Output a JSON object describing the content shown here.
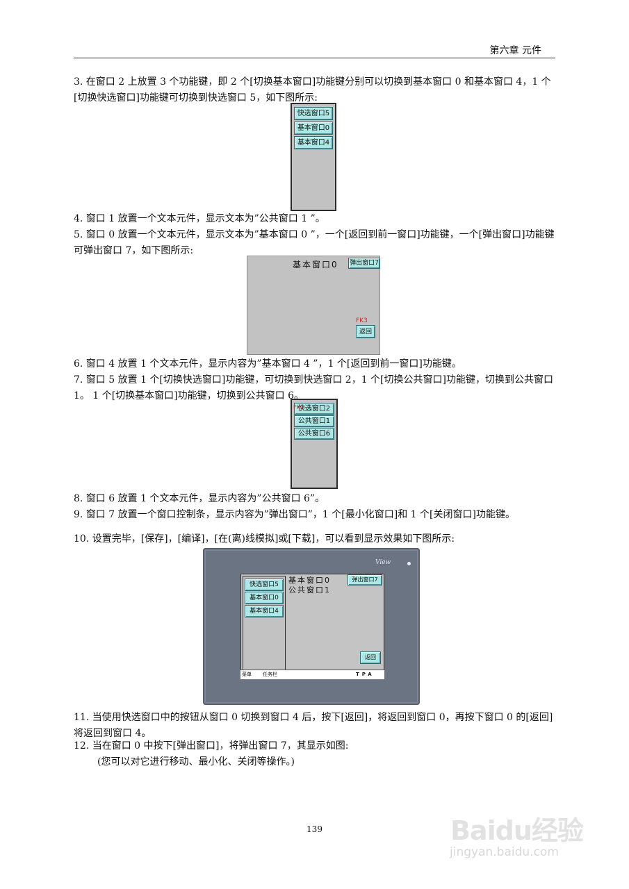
{
  "header": {
    "title": "第六章 元件"
  },
  "paragraphs": {
    "p3": "3. 在窗口 2 上放置 3 个功能键，即 2 个[切换基本窗口]功能键分别可以切换到基本窗口 0 和基本窗口 4，1 个[切换快选窗口]功能键可切换到快选窗口 5，如下图所示:",
    "p4": "4. 窗口 1 放置一个文本元件，显示文本为”公共窗口 1 ”。",
    "p5": "5. 窗口 0 放置一个文本元件，显示文本为”基本窗口 0 ”，一个[返回到前一窗口]功能键，一个[弹出窗口]功能键可弹出窗口 7，如下图所示:",
    "p6": "6. 窗口 4 放置 1 个文本元件，显示内容为”基本窗口 4 ”，1 个[返回到前一窗口]功能键。",
    "p7": "7. 窗口 5 放置 1 个[切换快选窗口]功能键，可切换到快选窗口 2，1 个[切换公共窗口]功能键，切换到公共窗口 1。 1 个[切换基本窗口]功能键，切换到公共窗口 6。",
    "p8": "8. 窗口 6 放置 1 个文本元件，显示内容为”公共窗口 6”。",
    "p9": "9. 窗口 7 放置一个窗口控制条，显示内容为”弹出窗口”，1 个[最小化窗口]和 1 个[关闭窗口]功能键。",
    "p10": "10. 设置完毕，[保存]，[编译]，[在(离)线模拟]或[下载]，可以看到显示效果如下图所示:",
    "p11": "11. 当使用快选窗口中的按钮从窗口 0 切换到窗口 4 后，按下[返回]，将返回到窗口 0，再按下窗口 0 的[返回]将返回到窗口 4。",
    "p12": "12. 当在窗口 0 中按下[弹出窗口]，将弹出窗口 7，其显示如图:",
    "p12_note": "(您可以对它进行移动、最小化、关闭等操作。)"
  },
  "fig1": {
    "buttons": [
      "快选窗口5",
      "基本窗口0",
      "基本窗口4"
    ]
  },
  "fig2": {
    "text": "基本窗口0",
    "popup_button": "弹出窗口7",
    "fk_label": "FK3",
    "back_button": "返回"
  },
  "fig3": {
    "fk_label": "FK0",
    "buttons": [
      "快选窗口2",
      "公共窗口1",
      "公共窗口6"
    ]
  },
  "fig4": {
    "logo": "View",
    "quick_buttons": [
      "快选窗口5",
      "基本窗口0",
      "基本窗口4"
    ],
    "text_line1": "基本窗口0",
    "text_line2": "公共窗口1",
    "popup_button": "弹出窗口7",
    "back_button": "返回",
    "taskbar_menu": "菜单",
    "taskbar_tasks": "任务栏",
    "taskbar_icons": "TPA"
  },
  "page_number": "139",
  "watermark": {
    "logo": "Baidu经验",
    "url": "jingyan.baidu.com"
  }
}
